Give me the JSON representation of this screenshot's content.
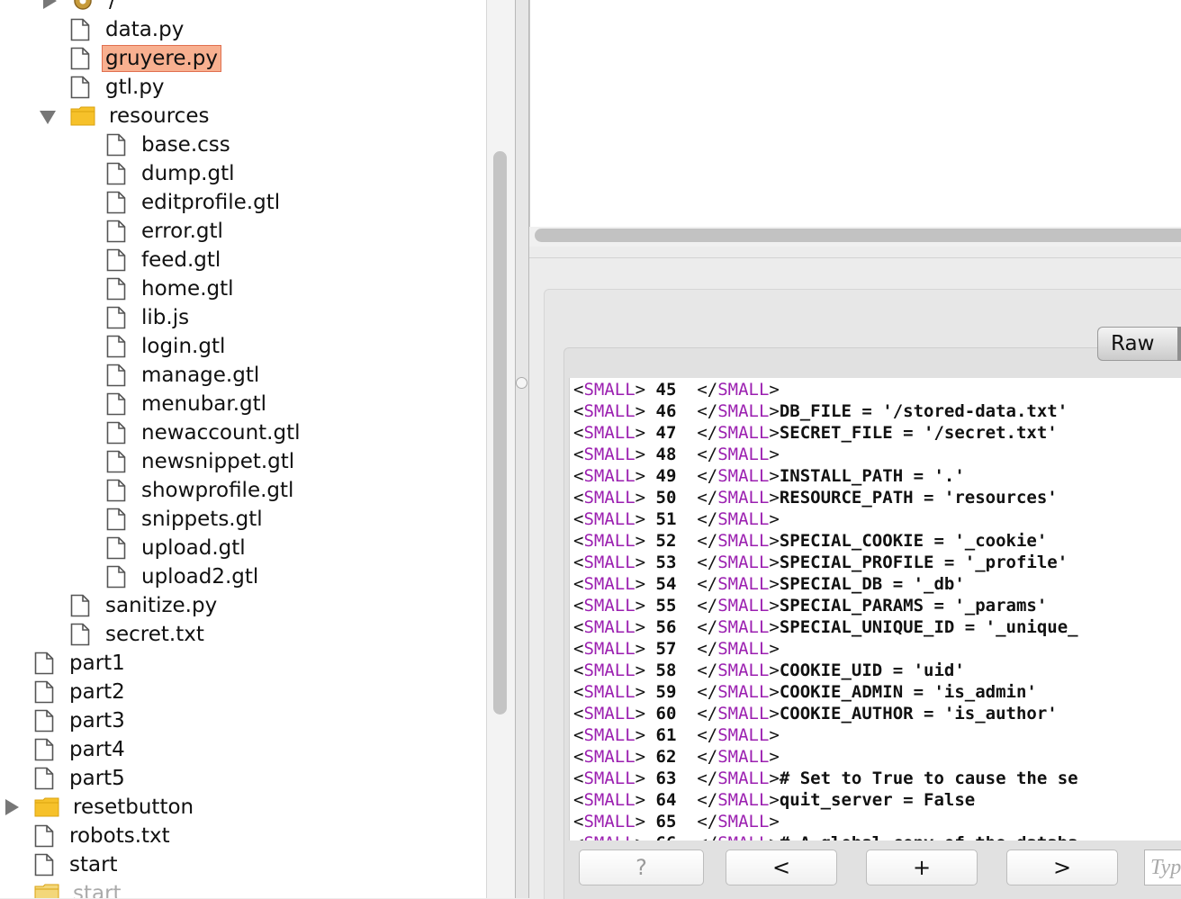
{
  "tree": {
    "items": [
      {
        "label": "/",
        "kind": "gear",
        "indent": 0
      },
      {
        "label": "data.py",
        "kind": "file",
        "indent": 1
      },
      {
        "label": "gruyere.py",
        "kind": "file",
        "indent": 1,
        "selected": true
      },
      {
        "label": "gtl.py",
        "kind": "file",
        "indent": 1
      },
      {
        "label": "resources",
        "kind": "folder-open",
        "indent": 1
      },
      {
        "label": "base.css",
        "kind": "file",
        "indent": 2
      },
      {
        "label": "dump.gtl",
        "kind": "file",
        "indent": 2
      },
      {
        "label": "editprofile.gtl",
        "kind": "file",
        "indent": 2
      },
      {
        "label": "error.gtl",
        "kind": "file",
        "indent": 2
      },
      {
        "label": "feed.gtl",
        "kind": "file",
        "indent": 2
      },
      {
        "label": "home.gtl",
        "kind": "file",
        "indent": 2
      },
      {
        "label": "lib.js",
        "kind": "file",
        "indent": 2
      },
      {
        "label": "login.gtl",
        "kind": "file",
        "indent": 2
      },
      {
        "label": "manage.gtl",
        "kind": "file",
        "indent": 2
      },
      {
        "label": "menubar.gtl",
        "kind": "file",
        "indent": 2
      },
      {
        "label": "newaccount.gtl",
        "kind": "file",
        "indent": 2
      },
      {
        "label": "newsnippet.gtl",
        "kind": "file",
        "indent": 2
      },
      {
        "label": "showprofile.gtl",
        "kind": "file",
        "indent": 2
      },
      {
        "label": "snippets.gtl",
        "kind": "file",
        "indent": 2
      },
      {
        "label": "upload.gtl",
        "kind": "file",
        "indent": 2
      },
      {
        "label": "upload2.gtl",
        "kind": "file",
        "indent": 2
      },
      {
        "label": "sanitize.py",
        "kind": "file",
        "indent": 1
      },
      {
        "label": "secret.txt",
        "kind": "file",
        "indent": 1
      },
      {
        "label": "part1",
        "kind": "file",
        "indent": 0
      },
      {
        "label": "part2",
        "kind": "file",
        "indent": 0
      },
      {
        "label": "part3",
        "kind": "file",
        "indent": 0
      },
      {
        "label": "part4",
        "kind": "file",
        "indent": 0
      },
      {
        "label": "part5",
        "kind": "file",
        "indent": 0
      },
      {
        "label": "resetbutton",
        "kind": "folder-closed",
        "indent": 0
      },
      {
        "label": "robots.txt",
        "kind": "file",
        "indent": 0
      },
      {
        "label": "start",
        "kind": "file",
        "indent": 0
      },
      {
        "label": "start",
        "kind": "folder-dim",
        "indent": 0,
        "dim": true
      }
    ]
  },
  "viewer": {
    "raw_label": "Raw",
    "open_tag": "SMALL",
    "lines": [
      {
        "n": "45",
        "code": ""
      },
      {
        "n": "46",
        "code": "DB_FILE = '/stored-data.txt'"
      },
      {
        "n": "47",
        "code": "SECRET_FILE = '/secret.txt'"
      },
      {
        "n": "48",
        "code": ""
      },
      {
        "n": "49",
        "code": "INSTALL_PATH = '.'"
      },
      {
        "n": "50",
        "code": "RESOURCE_PATH = 'resources'"
      },
      {
        "n": "51",
        "code": ""
      },
      {
        "n": "52",
        "code": "SPECIAL_COOKIE = '_cookie'"
      },
      {
        "n": "53",
        "code": "SPECIAL_PROFILE = '_profile'"
      },
      {
        "n": "54",
        "code": "SPECIAL_DB = '_db'"
      },
      {
        "n": "55",
        "code": "SPECIAL_PARAMS = '_params'"
      },
      {
        "n": "56",
        "code": "SPECIAL_UNIQUE_ID = '_unique_"
      },
      {
        "n": "57",
        "code": ""
      },
      {
        "n": "58",
        "code": "COOKIE_UID = 'uid'"
      },
      {
        "n": "59",
        "code": "COOKIE_ADMIN = 'is_admin'"
      },
      {
        "n": "60",
        "code": "COOKIE_AUTHOR = 'is_author'"
      },
      {
        "n": "61",
        "code": ""
      },
      {
        "n": "62",
        "code": ""
      },
      {
        "n": "63",
        "code": "# Set to True to cause the se"
      },
      {
        "n": "64",
        "code": "quit_server = False"
      },
      {
        "n": "65",
        "code": ""
      },
      {
        "n": "66",
        "code": "# A global copy of the databa"
      }
    ]
  },
  "buttons": {
    "help": "?",
    "prev": "<",
    "add": "+",
    "next": ">",
    "type_placeholder": "Type"
  }
}
